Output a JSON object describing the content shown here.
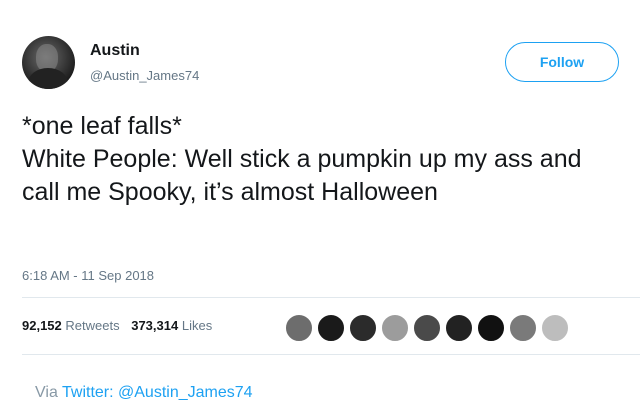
{
  "user": {
    "name": "Austin",
    "handle": "@Austin_James74"
  },
  "follow_label": "Follow",
  "tweet_text": "*one leaf falls*\nWhite People: Well stick a pumpkin up my ass and call me Spooky, it’s almost Halloween",
  "timestamp": "6:18 AM - 11 Sep 2018",
  "stats": {
    "retweets_count": "92,152",
    "retweets_label": "Retweets",
    "likes_count": "373,314",
    "likes_label": "Likes"
  },
  "likers": [
    {
      "color": "#6d6d6d"
    },
    {
      "color": "#1a1a1a"
    },
    {
      "color": "#2b2b2b"
    },
    {
      "color": "#9c9c9c"
    },
    {
      "color": "#4a4a4a"
    },
    {
      "color": "#222222"
    },
    {
      "color": "#111111"
    },
    {
      "color": "#7a7a7a"
    },
    {
      "color": "#bdbdbd"
    }
  ],
  "via": {
    "prefix": "Via",
    "source": "Twitter: @Austin_James74"
  },
  "colors": {
    "accent": "#1da1f2",
    "muted": "#657786"
  }
}
